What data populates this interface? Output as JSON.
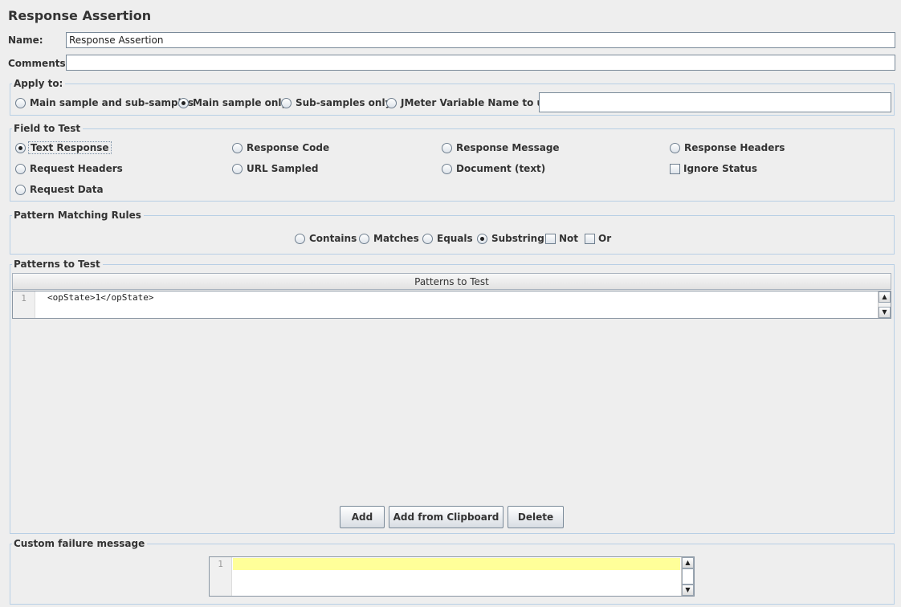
{
  "title": "Response Assertion",
  "name_label": "Name:",
  "name_value": "Response Assertion",
  "comments_label": "Comments:",
  "comments_value": "",
  "apply_to": {
    "title": "Apply to:",
    "options": [
      "Main sample and sub-samples",
      "Main sample only",
      "Sub-samples only",
      "JMeter Variable Name to use"
    ],
    "selected": "Main sample only",
    "variable_value": ""
  },
  "field_to_test": {
    "title": "Field to Test",
    "options": [
      "Text Response",
      "Response Code",
      "Response Message",
      "Response Headers",
      "Request Headers",
      "URL Sampled",
      "Document (text)",
      "Request Data"
    ],
    "selected": "Text Response",
    "ignore_status_label": "Ignore Status",
    "ignore_status_checked": false
  },
  "pattern_rules": {
    "title": "Pattern Matching Rules",
    "radios": [
      "Contains",
      "Matches",
      "Equals",
      "Substring"
    ],
    "selected": "Substring",
    "not_label": "Not",
    "or_label": "Or"
  },
  "patterns": {
    "title": "Patterns to Test",
    "column_header": "Patterns to Test",
    "rows": [
      {
        "line": "1",
        "text": "<opState>1</opState>"
      }
    ]
  },
  "buttons": {
    "add": "Add",
    "add_clipboard": "Add from Clipboard",
    "delete": "Delete"
  },
  "custom_failure": {
    "title": "Custom failure message",
    "line": "1",
    "text": ""
  },
  "colors": {
    "background": "#eeeeee",
    "group_border": "#b8cfe5",
    "highlight_line": "#ffff99"
  }
}
